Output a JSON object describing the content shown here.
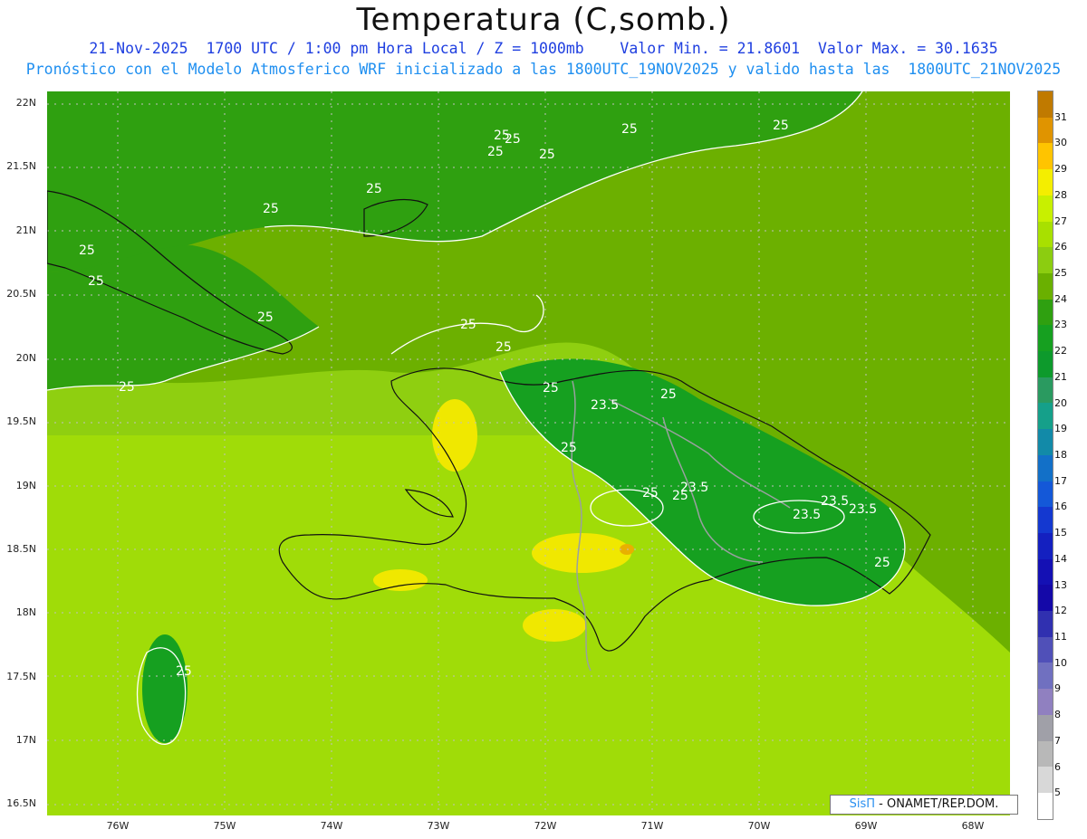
{
  "header": {
    "title": "Temperatura (C,somb.)",
    "line1": "21-Nov-2025  1700 UTC / 1:00 pm Hora Local / Z = 1000mb    Valor Min. = 21.8601  Valor Max. = 30.1635",
    "line2": "Pronóstico con el Modelo Atmosferico WRF inicializado a las 1800UTC_19NOV2025 y valido hasta las  1800UTC_21NOV2025"
  },
  "axes": {
    "lat_labels": [
      "22N",
      "21.5N",
      "21N",
      "20.5N",
      "20N",
      "19.5N",
      "19N",
      "18.5N",
      "18N",
      "17.5N",
      "17N",
      "16.5N"
    ],
    "lon_labels": [
      "76W",
      "75W",
      "74W",
      "73W",
      "72W",
      "71W",
      "70W",
      "69W",
      "68W"
    ]
  },
  "colorbar": {
    "labels": [
      "31",
      "30",
      "29",
      "28",
      "27",
      "26",
      "25",
      "24",
      "23",
      "22",
      "21",
      "20",
      "19",
      "18",
      "17",
      "16",
      "15",
      "14",
      "13",
      "12",
      "11",
      "10",
      "9",
      "8",
      "7",
      "6",
      "5"
    ],
    "colors": [
      "#c07a00",
      "#e09400",
      "#ffc400",
      "#f4ee00",
      "#c8f000",
      "#a8e000",
      "#8ccd10",
      "#6ab000",
      "#2fa010",
      "#16a020",
      "#0d9a2c",
      "#2a9a60",
      "#15a08a",
      "#128aa8",
      "#1270c8",
      "#1458d8",
      "#1438d0",
      "#1420c0",
      "#1410b4",
      "#1408a8",
      "#3030b0",
      "#5050b8",
      "#7070c0",
      "#9080c0",
      "#a0a0a8",
      "#b8b8b8",
      "#d8d8d8",
      "#ffffff"
    ]
  },
  "contour_labels": [
    "25",
    "25",
    "25",
    "25",
    "25",
    "25",
    "25",
    "25",
    "25",
    "25",
    "25",
    "25",
    "25",
    "25",
    "25",
    "23.5",
    "25",
    "25",
    "23.5",
    "23.5",
    "23.5",
    "23.5",
    "25",
    "25",
    "25",
    "25"
  ],
  "credit": {
    "logo": "SisΠ",
    "text": " - ONAMET/REP.DOM."
  }
}
